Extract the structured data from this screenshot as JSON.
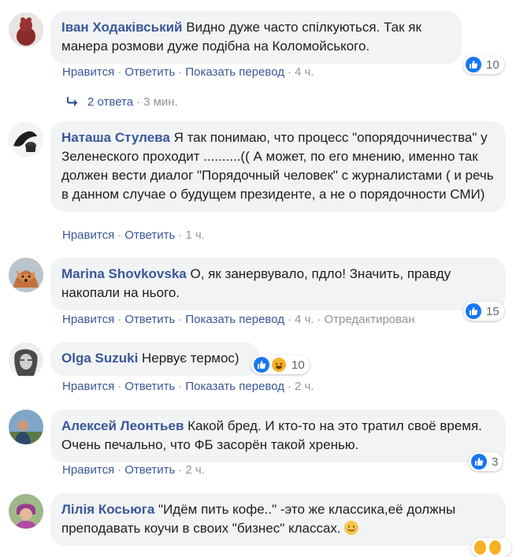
{
  "colors": {
    "link": "#385898",
    "bubble_bg": "#f2f3f5",
    "like_blue": "#1877f2",
    "meta_gray": "#90949c"
  },
  "actions": {
    "like": "Нравится",
    "reply": "Ответить",
    "translate": "Показать перевод",
    "separator": "·"
  },
  "comments": [
    {
      "author": "Іван Ходаківський",
      "text": "Видно дуже часто спілкуються. Так як манера розмови дуже подібна на Коломойського.",
      "time": "4 ч.",
      "reactions": {
        "icons": [
          "like-icon"
        ],
        "count": "10"
      }
    },
    {
      "author": "Наташа Стулева",
      "text": "Я так понимаю, что процесс \"опорядочничества\" у Зеленеского проходит ..........(( А может, по его мнению, именно так должен вести диалог \"Порядочный человек\" с журналистами ( и речь в данном случае о будущем президенте, а не о порядочности СМИ)",
      "time": "1 ч."
    },
    {
      "author": "Marina Shovkovska",
      "text": "О, як занервувало, пдло! Значить, правду накопали на нього.",
      "time": "4 ч.",
      "edited": "Отредактирован",
      "reactions": {
        "icons": [
          "like-icon"
        ],
        "count": "15"
      }
    },
    {
      "author": "Olga Suzuki",
      "text": "Нервує термос)",
      "time": "2 ч.",
      "reactions": {
        "icons": [
          "like-icon",
          "haha-icon"
        ],
        "count": "10"
      }
    },
    {
      "author": "Алексей Леонтьев",
      "text": "Какой бред. И кто-то на это тратил своё время. Очень печально, что ФБ засорён такой хренью.",
      "time": "2 ч.",
      "reactions": {
        "icons": [
          "like-icon"
        ],
        "count": "3"
      }
    },
    {
      "author": "Лілія Косьюга",
      "text": "\"Идём пить кофе..\" -это же классика,её должны преподавать коучи в своих \"бизнес\" классах."
    }
  ],
  "replies": {
    "count_label": "2 ответа",
    "time": "3 мин."
  }
}
